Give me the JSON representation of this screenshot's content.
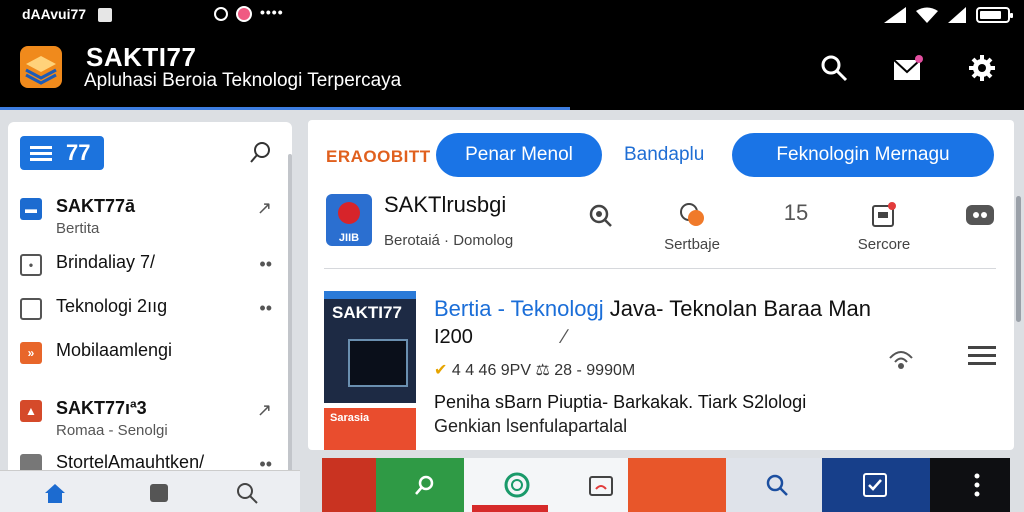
{
  "status_bar": {
    "time": "dAAvui77",
    "dots": "••••",
    "battery_level": 0.8
  },
  "app": {
    "title": "SAKTI77",
    "subtitle": "Apluhasi Beroia Teknologi Terpercaya",
    "actions": [
      "search-icon",
      "mail-icon",
      "gear-icon"
    ]
  },
  "sidebar": {
    "chip_number": "77",
    "items": [
      {
        "title": "SAKT77ā",
        "subtitle": "Bertita",
        "icon_color": "#1c6bd0",
        "trail": "↗"
      },
      {
        "title": "Brindaliay 7/",
        "subtitle": "",
        "icon_color": "#555555",
        "trail": "••"
      },
      {
        "title": "Teknologi 2ııg",
        "subtitle": "",
        "icon_color": "#555555",
        "trail": "••"
      },
      {
        "title": "Mobilaamlengi",
        "subtitle": "",
        "icon_color": "#e8662a",
        "trail": ""
      },
      {
        "title": "SAKT77ıª3",
        "subtitle": "Romaa - Senolgi",
        "icon_color": "#d54a2a",
        "trail": "↗"
      },
      {
        "title": "StortelAmauhtken/",
        "subtitle": "",
        "icon_color": "#777777",
        "trail": "••"
      }
    ]
  },
  "header_tabs": {
    "brand": "ERAOOBITT",
    "pill1": "Penar Menol",
    "plain": "Bandaplu",
    "pill2": "Feknologin   Mernagu"
  },
  "account": {
    "logo_text": "JIIB",
    "name": "SAKTlrusbgi",
    "meta": "Berotaiá · Domolog",
    "stats": [
      {
        "label": "",
        "icon": "search-icon"
      },
      {
        "label": "Sertbaje",
        "icon": "share-orange-icon"
      },
      {
        "label": "15",
        "icon": ""
      },
      {
        "label": "Sercore",
        "icon": "badge-icon"
      },
      {
        "label": "",
        "icon": "chat-icon"
      }
    ]
  },
  "article": {
    "thumb_title": "SAKTI77",
    "thumb2_text": "Sarasia",
    "title_highlight": "Bertia - Teknologj",
    "title_rest": " Java- Teknolan Baraa Man",
    "subtitle": "I200",
    "subtitle_mark": "∕",
    "meta_star": "✔",
    "meta": " 4 4 46 9PV ⚖ 28 - 9990M",
    "body1": "Peniha sBarn Piuptia- Barkakak. Tiark S2lologi",
    "body2": "Genkian lsenfulapartalal"
  },
  "bottom_nav": [
    "home-icon",
    "tabs-icon",
    "search-icon"
  ]
}
